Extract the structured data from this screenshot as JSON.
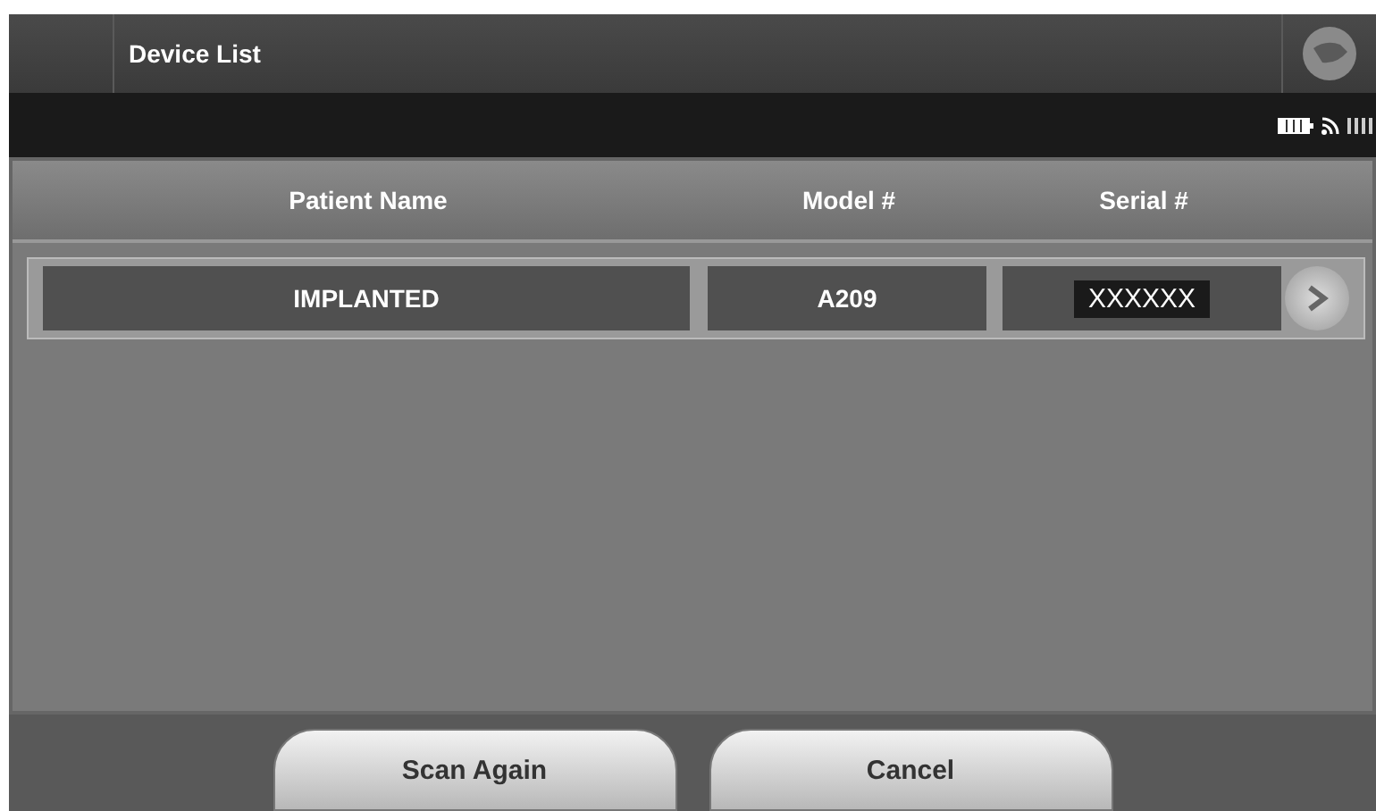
{
  "window": {
    "title": "Device List"
  },
  "table": {
    "columns": [
      "Patient Name",
      "Model #",
      "Serial #"
    ],
    "rows": [
      {
        "patient_name": "IMPLANTED",
        "model": "A209",
        "serial": "XXXXXX"
      }
    ]
  },
  "buttons": [
    "Scan Again",
    "Cancel"
  ]
}
